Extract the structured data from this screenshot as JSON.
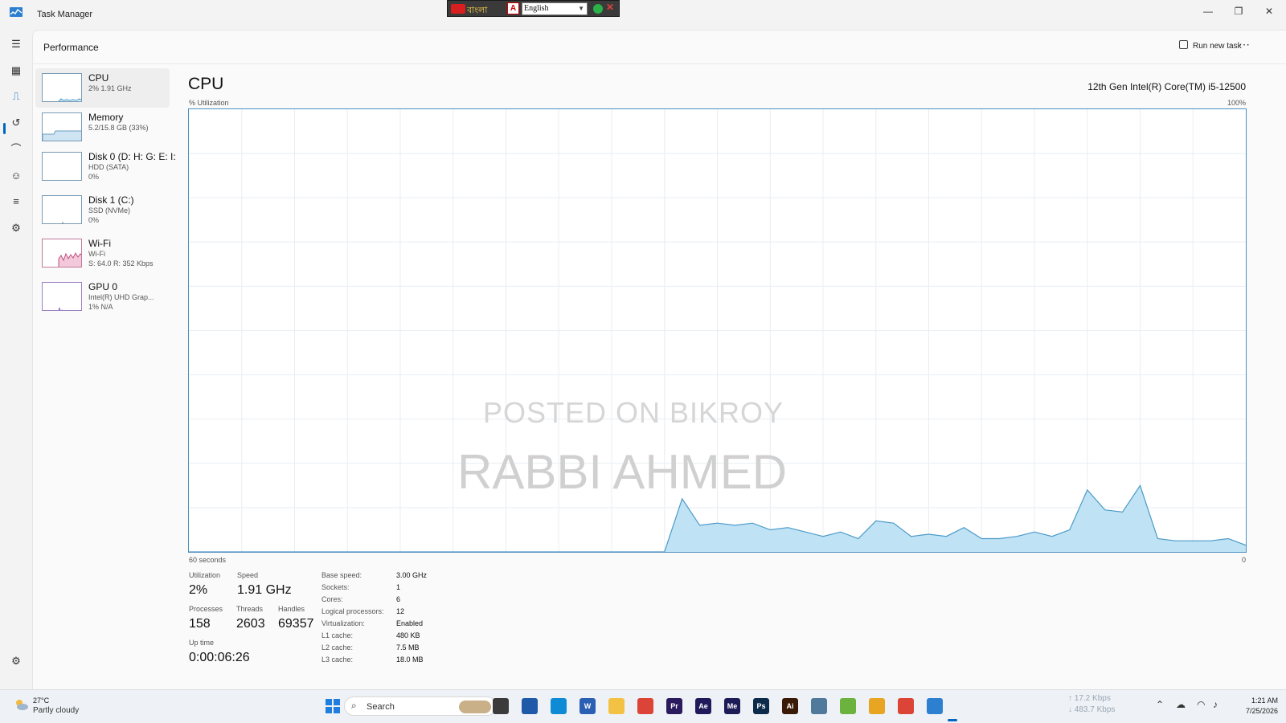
{
  "window": {
    "title": "Task Manager",
    "minimize_glyph": "—",
    "restore_glyph": "❐",
    "close_glyph": "✕"
  },
  "ime_toolbar": {
    "script_label": "বাংলা",
    "language": "English"
  },
  "header": {
    "page_title": "Performance",
    "run_new_task": "Run new task",
    "more_glyph": "⋯"
  },
  "sidebar": {
    "items": [
      {
        "name": "CPU",
        "sub": "2% 1.91 GHz",
        "sub2": ""
      },
      {
        "name": "Memory",
        "sub": "5.2/15.8 GB (33%)",
        "sub2": ""
      },
      {
        "name": "Disk 0 (D: H: G: E: I:",
        "sub": "HDD (SATA)",
        "sub2": "0%"
      },
      {
        "name": "Disk 1 (C:)",
        "sub": "SSD (NVMe)",
        "sub2": "0%"
      },
      {
        "name": "Wi-Fi",
        "sub": "Wi-Fi",
        "sub2": "S: 64.0 R: 352 Kbps"
      },
      {
        "name": "GPU 0",
        "sub": "Intel(R) UHD Grap...",
        "sub2": "1% N/A"
      }
    ]
  },
  "detail": {
    "title": "CPU",
    "model": "12th Gen Intel(R) Core(TM) i5-12500",
    "util_label": "% Utilization",
    "max_label": "100%",
    "time_label": "60 seconds",
    "zero_label": "0"
  },
  "watermark": {
    "line1": "POSTED ON BIKROY",
    "line2": "RABBI AHMED"
  },
  "chart_data": {
    "type": "area",
    "x_unit": "seconds",
    "x": [
      60,
      59,
      58,
      57,
      56,
      55,
      54,
      53,
      52,
      51,
      50,
      49,
      48,
      47,
      46,
      45,
      44,
      43,
      42,
      41,
      40,
      39,
      38,
      37,
      36,
      35,
      34,
      33,
      32,
      31,
      30,
      29,
      28,
      27,
      26,
      25,
      24,
      23,
      22,
      21,
      20,
      19,
      18,
      17,
      16,
      15,
      14,
      13,
      12,
      11,
      10,
      9,
      8,
      7,
      6,
      5,
      4,
      3,
      2,
      1,
      0
    ],
    "values": [
      0,
      0,
      0,
      0,
      0,
      0,
      0,
      0,
      0,
      0,
      0,
      0,
      0,
      0,
      0,
      0,
      0,
      0,
      0,
      0,
      0,
      0,
      0,
      0,
      0,
      0,
      0,
      0,
      12,
      6,
      6.5,
      6,
      6.5,
      5,
      5.5,
      4.5,
      3.5,
      4.5,
      3,
      7,
      6.5,
      3.5,
      4,
      3.5,
      5.5,
      3,
      3,
      3.5,
      4.5,
      3.5,
      5,
      14,
      9.5,
      9,
      15,
      3,
      2.5,
      2.5,
      2.5,
      3,
      1.5
    ],
    "ylim": [
      0,
      100
    ],
    "grid": true,
    "color": "#bfe3f4",
    "line_color": "#4d9ac9"
  },
  "stats": {
    "utilization_label": "Utilization",
    "utilization": "2%",
    "speed_label": "Speed",
    "speed": "1.91 GHz",
    "processes_label": "Processes",
    "processes": "158",
    "threads_label": "Threads",
    "threads": "2603",
    "handles_label": "Handles",
    "handles": "69357",
    "uptime_label": "Up time",
    "uptime": "0:00:06:26"
  },
  "specs": [
    {
      "key": "Base speed:",
      "value": "3.00 GHz"
    },
    {
      "key": "Sockets:",
      "value": "1"
    },
    {
      "key": "Cores:",
      "value": "6"
    },
    {
      "key": "Logical processors:",
      "value": "12"
    },
    {
      "key": "Virtualization:",
      "value": "Enabled"
    },
    {
      "key": "L1 cache:",
      "value": "480 KB"
    },
    {
      "key": "L2 cache:",
      "value": "7.5 MB"
    },
    {
      "key": "L3 cache:",
      "value": "18.0 MB"
    }
  ],
  "taskbar": {
    "weather_temp": "27°C",
    "weather_desc": "Partly cloudy",
    "search_placeholder": "Search",
    "net_up": "17.2 Kbps",
    "net_down": "483.7 Kbps",
    "time": "1:21 AM",
    "date": "7/25/2026",
    "apps": [
      {
        "icon": "file-explorer-task-icon",
        "label": "",
        "color": "#3b3b3b"
      },
      {
        "icon": "store-icon",
        "label": "",
        "color": "#1f5aa8"
      },
      {
        "icon": "edge-icon",
        "label": "",
        "color": "#0f8bd6"
      },
      {
        "icon": "word-icon",
        "label": "W",
        "color": "#2b5fb4"
      },
      {
        "icon": "folder-icon",
        "label": "",
        "color": "#f3c244"
      },
      {
        "icon": "chrome-icon",
        "label": "",
        "color": "#db4437"
      },
      {
        "icon": "premiere-icon",
        "label": "Pr",
        "color": "#2a1a5e"
      },
      {
        "icon": "after-effects-icon",
        "label": "Ae",
        "color": "#1f1a5a"
      },
      {
        "icon": "media-encoder-icon",
        "label": "Me",
        "color": "#1e1c56"
      },
      {
        "icon": "photoshop-icon",
        "label": "Ps",
        "color": "#0c2a4a"
      },
      {
        "icon": "illustrator-icon",
        "label": "Ai",
        "color": "#3a1a06"
      },
      {
        "icon": "app-window-icon",
        "label": "",
        "color": "#4f7a9c"
      },
      {
        "icon": "utorrent-icon",
        "label": "",
        "color": "#6bb33c"
      },
      {
        "icon": "drive-icon",
        "label": "",
        "color": "#e7a521"
      },
      {
        "icon": "chrome-icon-2",
        "label": "",
        "color": "#db4437"
      },
      {
        "icon": "task-manager-icon",
        "label": "",
        "color": "#2d7fd0"
      }
    ]
  }
}
